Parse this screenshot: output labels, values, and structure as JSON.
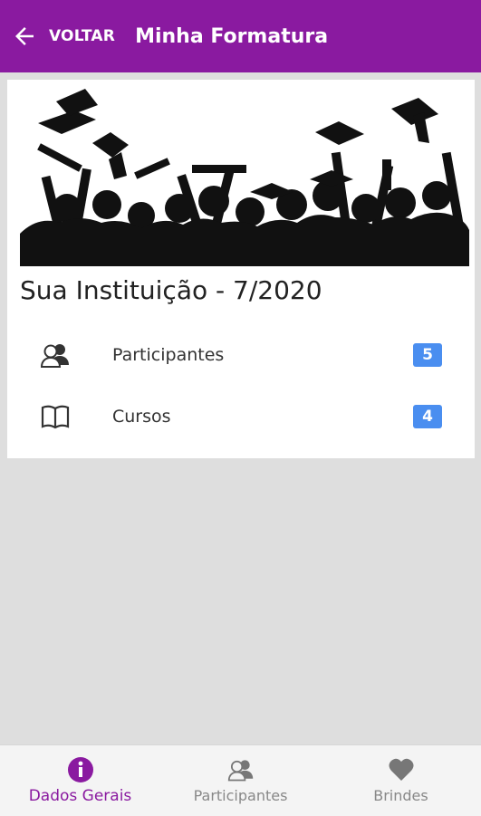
{
  "header": {
    "back_label": "VOLTAR",
    "title": "Minha Formatura",
    "bar_color": "#8a1aa0"
  },
  "card": {
    "institution_title": "Sua Instituição - 7/2020",
    "rows": [
      {
        "icon": "participants-icon",
        "label": "Participantes",
        "count": "5"
      },
      {
        "icon": "book-icon",
        "label": "Cursos",
        "count": "4"
      }
    ],
    "badge_color": "#4a8ef0"
  },
  "bottom_nav": {
    "tabs": [
      {
        "icon": "info-icon",
        "label": "Dados Gerais",
        "active": true
      },
      {
        "icon": "participants-icon",
        "label": "Participantes",
        "active": false
      },
      {
        "icon": "heart-icon",
        "label": "Brindes",
        "active": false
      }
    ],
    "active_color": "#8a1aa0"
  }
}
